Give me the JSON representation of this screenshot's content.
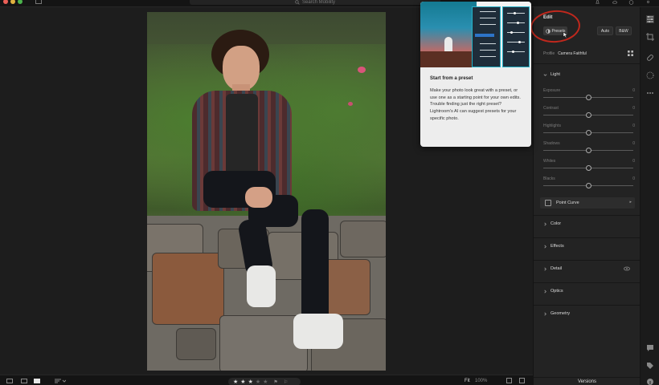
{
  "search": {
    "placeholder": "Search Mobility"
  },
  "panel": {
    "title": "Edit",
    "presets_label": "Presets",
    "auto_label": "Auto",
    "bw_label": "B&W",
    "profile_label": "Profile",
    "profile_value": "Camera Faithful",
    "light_section": "Light",
    "sliders": [
      {
        "label": "Exposure",
        "value": "0",
        "level": 0.5
      },
      {
        "label": "Contrast",
        "value": "0",
        "level": 0.5
      },
      {
        "label": "Highlights",
        "value": "0",
        "level": 0.5
      },
      {
        "label": "Shadows",
        "value": "0",
        "level": 0.5
      },
      {
        "label": "Whites",
        "value": "0",
        "level": 0.5
      },
      {
        "label": "Blacks",
        "value": "0",
        "level": 0.5
      }
    ],
    "point_curve": "Point Curve",
    "sections": [
      "Color",
      "Effects",
      "Detail",
      "Optics",
      "Geometry"
    ],
    "versions": "Versions"
  },
  "tooltip": {
    "title": "Start from a preset",
    "body": "Make your photo look great with a preset, or use one as a starting point for your own edits. Trouble finding just the right preset? Lightroom's AI can suggest presets for your specific photo."
  },
  "bottom": {
    "rating": 3,
    "rating_max": 5,
    "fit_label": "Fit",
    "zoom_label": "100%"
  },
  "colors": {
    "highlight_ring": "#c0281d",
    "panel_bg": "#232323",
    "accent": "#24b2c8"
  },
  "icons": {
    "rail": [
      "sliders-icon",
      "crop-icon",
      "healing-icon",
      "masking-icon",
      "more-icon",
      "comment-icon",
      "tag-icon",
      "info-icon"
    ]
  }
}
